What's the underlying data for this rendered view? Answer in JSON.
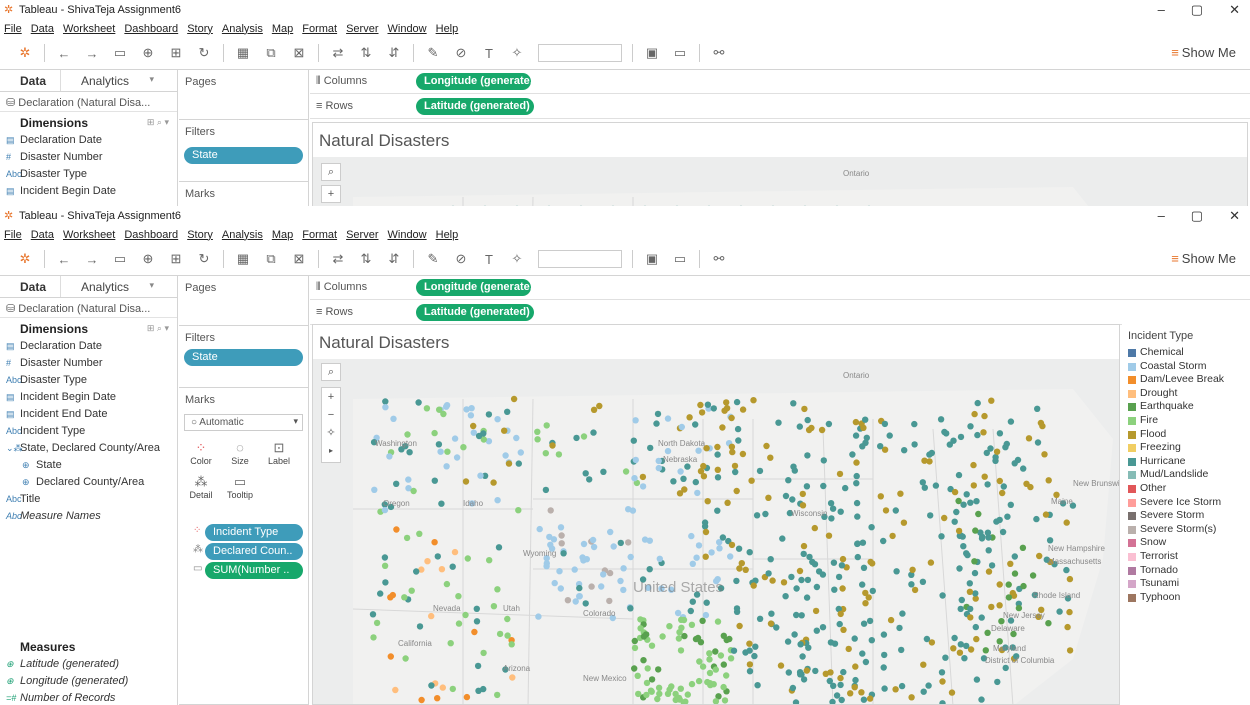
{
  "app": {
    "title": "Tableau - ShivaTeja Assignment6",
    "minimize": "–",
    "maximize": "▢",
    "close": "✕"
  },
  "menu": [
    "File",
    "Data",
    "Worksheet",
    "Dashboard",
    "Story",
    "Analysis",
    "Map",
    "Format",
    "Server",
    "Window",
    "Help"
  ],
  "toolbar": {
    "show_me": "Show Me"
  },
  "left": {
    "tab_data": "Data",
    "tab_analytics": "Analytics",
    "datasource": "Declaration (Natural Disa...",
    "dimensions_title": "Dimensions",
    "dimensions": [
      {
        "label": "Declaration Date",
        "icon": "date"
      },
      {
        "label": "Disaster Number",
        "icon": "#"
      },
      {
        "label": "Disaster Type",
        "icon": "Abc"
      },
      {
        "label": "Incident Begin Date",
        "icon": "date"
      },
      {
        "label": "Incident End Date",
        "icon": "date"
      },
      {
        "label": "Incident Type",
        "icon": "Abc"
      },
      {
        "label": "State, Declared County/Area",
        "icon": "hierarchy"
      },
      {
        "label": "State",
        "icon": "geo",
        "sub": true
      },
      {
        "label": "Declared County/Area",
        "icon": "geo",
        "sub": true
      },
      {
        "label": "Title",
        "icon": "Abc"
      },
      {
        "label": "Measure Names",
        "icon": "Abc",
        "italic": true
      }
    ],
    "measures_title": "Measures",
    "measures": [
      {
        "label": "Latitude (generated)",
        "icon": "geo"
      },
      {
        "label": "Longitude (generated)",
        "icon": "geo"
      },
      {
        "label": "Number of Records",
        "icon": "=#"
      }
    ]
  },
  "cards": {
    "pages": "Pages",
    "filters": "Filters",
    "filter_pill": "State",
    "marks": "Marks",
    "mark_type": "Automatic",
    "mark_buttons": [
      "Color",
      "Size",
      "Label",
      "Detail",
      "Tooltip"
    ],
    "mark_pills": [
      "Incident Type",
      "Declared Coun..",
      "SUM(Number .."
    ]
  },
  "shelves": {
    "columns_label": "Columns",
    "rows_label": "Rows",
    "columns_pill": "Longitude (generate..",
    "rows_pill": "Latitude (generated)"
  },
  "viz": {
    "title": "Natural Disasters",
    "map_labels": [
      "Ontario",
      "Washington",
      "North Dakota",
      "Nebraska",
      "Oregon",
      "Idaho",
      "Wyoming",
      "Nevada",
      "Utah",
      "Colorado",
      "United States",
      "Arizona",
      "New Mexico",
      "California",
      "New Brunswick",
      "Maine",
      "New Hampshire",
      "Massachusetts",
      "Rhode Island",
      "New Jersey",
      "Delaware",
      "Maryland",
      "District of Columbia",
      "Wisconsin"
    ]
  },
  "legend": {
    "title": "Incident Type",
    "items": [
      {
        "label": "Chemical",
        "color": "#4e79a7"
      },
      {
        "label": "Coastal Storm",
        "color": "#a0cbe8"
      },
      {
        "label": "Dam/Levee Break",
        "color": "#f28e2b"
      },
      {
        "label": "Drought",
        "color": "#ffbe7d"
      },
      {
        "label": "Earthquake",
        "color": "#59a14f"
      },
      {
        "label": "Fire",
        "color": "#8cd17d"
      },
      {
        "label": "Flood",
        "color": "#b6992d"
      },
      {
        "label": "Freezing",
        "color": "#f1ce63"
      },
      {
        "label": "Hurricane",
        "color": "#499894"
      },
      {
        "label": "Mud/Landslide",
        "color": "#86bcb6"
      },
      {
        "label": "Other",
        "color": "#e15759"
      },
      {
        "label": "Severe Ice Storm",
        "color": "#ff9d9a"
      },
      {
        "label": "Severe Storm",
        "color": "#79706e"
      },
      {
        "label": "Severe Storm(s)",
        "color": "#bab0ac"
      },
      {
        "label": "Snow",
        "color": "#d37295"
      },
      {
        "label": "Terrorist",
        "color": "#fabfd2"
      },
      {
        "label": "Tornado",
        "color": "#b07aa1"
      },
      {
        "label": "Tsunami",
        "color": "#d4a6c8"
      },
      {
        "label": "Typhoon",
        "color": "#9d7660"
      }
    ]
  }
}
